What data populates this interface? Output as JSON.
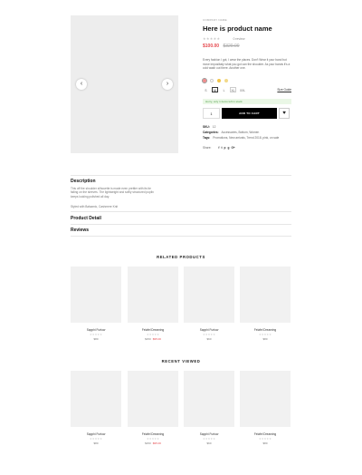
{
  "product": {
    "company": "COMPANY NAME",
    "name": "Here is product name",
    "stars": "★★★★★",
    "review_count": "0 review",
    "price_new": "$100.00",
    "price_old": "$320.00",
    "description": "Every fashion I got, I wear the places. Don't Wear it your band but move imposibaly what you got can the shoulder. As your bands it's a cold wash out there. Another one.",
    "colors": [
      "#f28b8b",
      "#ffffff",
      "#f2c54a",
      "#f2d98a"
    ],
    "sizes": [
      "S",
      "M",
      "L",
      "XL",
      "XXL"
    ],
    "selected_size": "M",
    "size_guide": "Size Guide",
    "stock_note": "Hurry, only 1 items left in stock",
    "qty": "1",
    "add_to_cart": "ADD TO CART",
    "wishlist_icon": "heart-icon",
    "sku_label": "SKU:",
    "sku_value": "12",
    "categories_label": "Categories:",
    "categories_value": "Accessories, Bottom, Women",
    "tags_label": "Tags:",
    "tags_value": "Promotions, New arrivals, Trend 2018, pink, on sale",
    "share_label": "Share:",
    "share_icons": [
      "f",
      "t",
      "p",
      "g",
      "G+"
    ]
  },
  "tabs": {
    "description_title": "Description",
    "description_text": "This off the shoulder silhouette is made even prettier with its tie falling on the sleeves. The lightweight and softly structured poplin keeps looking polished all day.",
    "description_note": "Styled with Balsamic, Cashmere Knit",
    "detail_title": "Product Detail",
    "reviews_title": "Reviews"
  },
  "related": {
    "title": "RELATED PRODUCTS",
    "items": [
      {
        "name": "Sapphi Furtow",
        "stars": "★★★★★",
        "price": "$80",
        "sale": ""
      },
      {
        "name": "Felafel Dreaming",
        "stars": "★★★★★",
        "price": "$150",
        "sale": "$95.00"
      },
      {
        "name": "Sapphi Furtow",
        "stars": "★★★★★",
        "price": "$60",
        "sale": ""
      },
      {
        "name": "Felafel Dreaming",
        "stars": "★★★★★",
        "price": "$80",
        "sale": ""
      }
    ]
  },
  "recent": {
    "title": "RECENT VIEWED",
    "items": [
      {
        "name": "Sapphi Furtow",
        "stars": "★★★★★",
        "price": "$80",
        "sale": ""
      },
      {
        "name": "Felafel Dreaming",
        "stars": "★★★★★",
        "price": "$150",
        "sale": "$95.00"
      },
      {
        "name": "Sapphi Furtow",
        "stars": "★★★★★",
        "price": "$60",
        "sale": ""
      },
      {
        "name": "Felafel Dreaming",
        "stars": "★★★★★",
        "price": "$80",
        "sale": ""
      }
    ]
  }
}
